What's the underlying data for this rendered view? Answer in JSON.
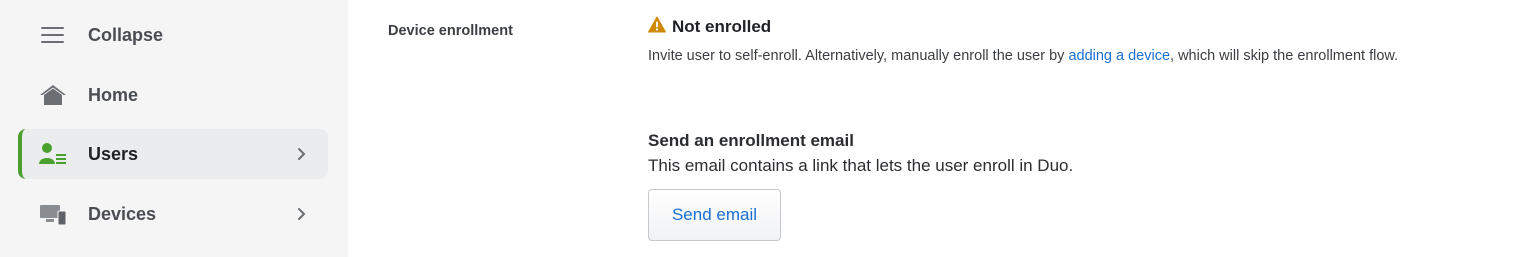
{
  "sidebar": {
    "items": [
      {
        "label": "Collapse",
        "icon": "hamburger-icon"
      },
      {
        "label": "Home",
        "icon": "home-icon"
      },
      {
        "label": "Users",
        "icon": "users-icon",
        "active": true
      },
      {
        "label": "Devices",
        "icon": "devices-icon"
      }
    ]
  },
  "main": {
    "field_label": "Device enrollment",
    "status": {
      "icon": "warning-icon",
      "text": "Not enrolled"
    },
    "description": {
      "before": "Invite user to self-enroll. Alternatively, manually enroll the user by ",
      "link": "adding a device",
      "after": ", which will skip the enrollment flow."
    },
    "enrollment_email": {
      "title": "Send an enrollment email",
      "description": "This email contains a link that lets the user enroll in Duo.",
      "button_label": "Send email"
    }
  },
  "colors": {
    "accent_green": "#4aa02c",
    "link_blue": "#1a6fd4",
    "warning_amber": "#d08a00",
    "sidebar_bg": "#f5f5f6"
  }
}
